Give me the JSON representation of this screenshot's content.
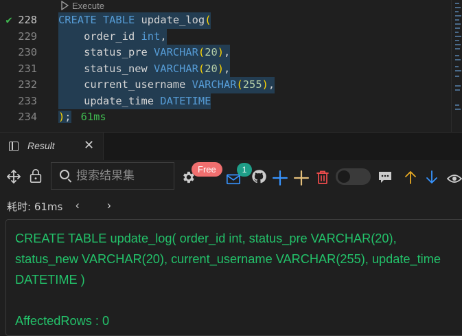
{
  "editor": {
    "codelens_label": "Execute",
    "lines": [
      {
        "num": "228",
        "status": "✔"
      },
      {
        "num": "229"
      },
      {
        "num": "230"
      },
      {
        "num": "231"
      },
      {
        "num": "232"
      },
      {
        "num": "233"
      },
      {
        "num": "234"
      }
    ],
    "code": {
      "create": "CREATE",
      "table": "TABLE",
      "table_name": "update_log",
      "open_paren": "(",
      "col1": "order_id",
      "col1_type": "int",
      "col2": "status_pre",
      "col3": "status_new",
      "col4": "current_username",
      "col5": "update_time",
      "varchar": "VARCHAR",
      "len20": "20",
      "len255": "255",
      "datetime": "DATETIME",
      "close_paren": ")",
      "semicolon": ";",
      "exec_time": "61ms"
    }
  },
  "panel": {
    "tab_label": "Result",
    "tab_close": "✕",
    "search_placeholder": "搜索结果集",
    "free_badge": "Free",
    "notification_count": "1",
    "elapsed_label": "耗时: 61ms",
    "nav_prev": "‹",
    "nav_next": "›",
    "result_sql": "CREATE TABLE update_log( order_id int, status_pre VARCHAR(20), status_new VARCHAR(20), current_username VARCHAR(255), update_time DATETIME )",
    "affected_rows": "AffectedRows : 0"
  },
  "colors": {
    "keyword": "#569cd6",
    "bracket": "#ffd700",
    "number": "#b5cea8",
    "success": "#23c26a",
    "free_badge": "#f06f6f",
    "count_badge": "#1f9e88",
    "add_blue": "#3794ff",
    "add_yellow": "#e5c07b",
    "delete_red": "#f14c4c"
  },
  "icons": [
    "play-icon",
    "check-icon",
    "result-tab-icon",
    "close-icon",
    "move-icon",
    "lock-icon",
    "search-icon",
    "gear-icon",
    "mail-icon",
    "github-icon",
    "add-row-icon",
    "add-icon",
    "trash-icon",
    "toggle-switch",
    "comment-icon",
    "arrow-up-icon",
    "arrow-down-icon",
    "eye-icon"
  ]
}
